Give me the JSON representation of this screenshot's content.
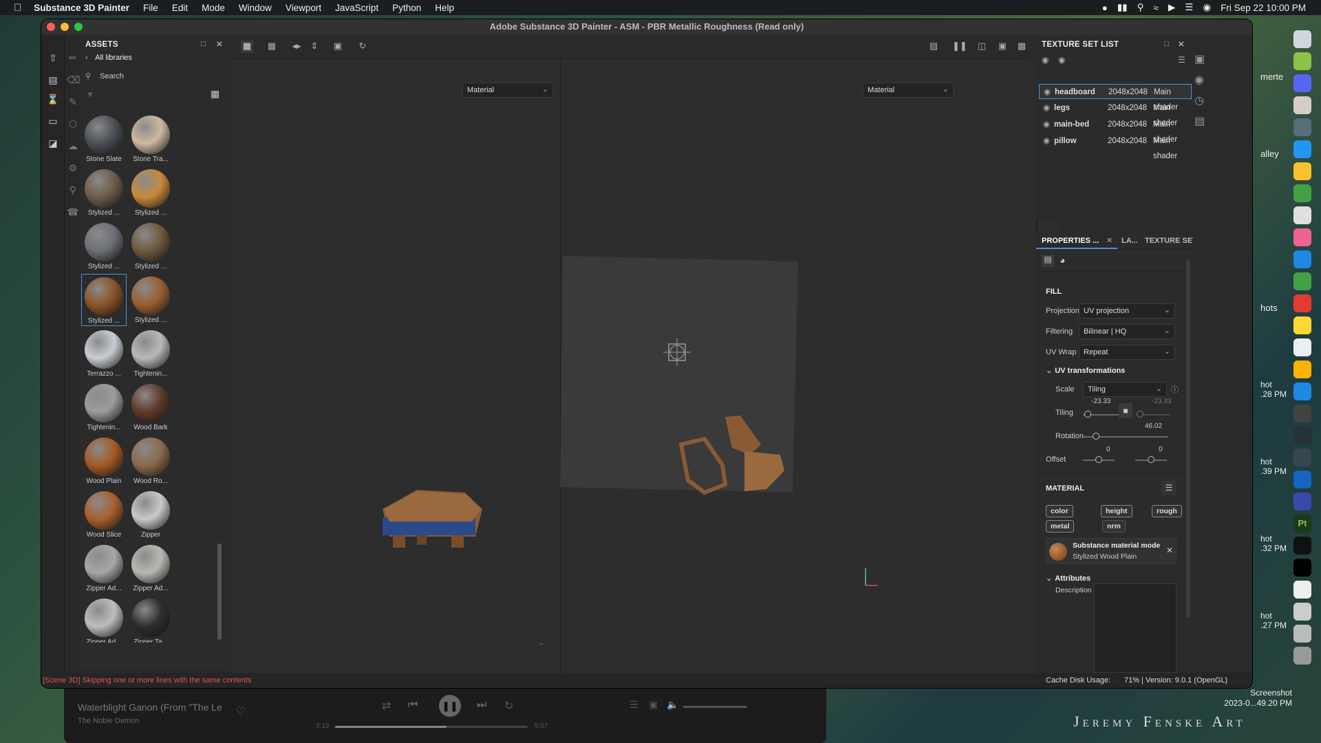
{
  "menubar": {
    "app_name": "Substance 3D Painter",
    "items": [
      "File",
      "Edit",
      "Mode",
      "Window",
      "Viewport",
      "JavaScript",
      "Python",
      "Help"
    ],
    "datetime": "Fri Sep 22  10:00 PM"
  },
  "window": {
    "title": "Adobe Substance 3D Painter - ASM - PBR Metallic Roughness (Read only)"
  },
  "assets": {
    "title": "ASSETS",
    "all_libraries": "All libraries",
    "search_placeholder": "Search",
    "swatches": [
      {
        "label": "Stone Slate",
        "color": "#4b4f57"
      },
      {
        "label": "Stone Tra...",
        "color": "#cdb9a1"
      },
      {
        "label": "Stylized ...",
        "color": "#6e5c4a"
      },
      {
        "label": "Stylized ...",
        "color": "#c9893b"
      },
      {
        "label": "Stylized ...",
        "color": "#6c6f75"
      },
      {
        "label": "Stylized ...",
        "color": "#6f5a3d"
      },
      {
        "label": "Stylized ...",
        "color": "#8b5428"
      },
      {
        "label": "Stylized ...",
        "color": "#9a5f30"
      },
      {
        "label": "Terrazzo ...",
        "color": "#c8cdd2"
      },
      {
        "label": "Tightenin...",
        "color": "#b8b8b8"
      },
      {
        "label": "Tightenin...",
        "color": "#9c9c9c"
      },
      {
        "label": "Wood Bark",
        "color": "#5e3b2a"
      },
      {
        "label": "Wood Plain",
        "color": "#a55a24"
      },
      {
        "label": "Wood Ro...",
        "color": "#8b6a4d"
      },
      {
        "label": "Wood Slice",
        "color": "#a9602c"
      },
      {
        "label": "Zipper",
        "color": "#c8c8c8"
      },
      {
        "label": "Zipper Ad...",
        "color": "#a7a7a7"
      },
      {
        "label": "Zipper Ad...",
        "color": "#b9b9b3"
      },
      {
        "label": "Zipper Ad...",
        "color": "#bdbdbd"
      },
      {
        "label": "Zipper Ta...",
        "color": "#2e2e2e"
      }
    ]
  },
  "viewport": {
    "left_dropdown": "Material",
    "right_dropdown": "Material"
  },
  "texture_set_list": {
    "title": "TEXTURE SET LIST",
    "rows": [
      {
        "name": "headboard",
        "size": "2048x2048",
        "shader": "Main shader"
      },
      {
        "name": "legs",
        "size": "2048x2048",
        "shader": "Main shader"
      },
      {
        "name": "main-bed",
        "size": "2048x2048",
        "shader": "Main shader"
      },
      {
        "name": "pillow",
        "size": "2048x2048",
        "shader": "Main shader"
      }
    ]
  },
  "properties": {
    "tabs": [
      "PROPERTIES ...",
      "LA...",
      "TEXTURE SET SET..."
    ],
    "fill_title": "FILL",
    "projection_label": "Projection",
    "projection_value": "UV projection",
    "filtering_label": "Filtering",
    "filtering_value": "Bilinear | HQ",
    "uvwrap_label": "UV Wrap",
    "uvwrap_value": "Repeat",
    "uvtrans_title": "UV transformations",
    "scale_label": "Scale",
    "scale_value": "Tiling",
    "tiling_label": "Tiling",
    "tiling_x": "-23.33",
    "tiling_y": "-23.33",
    "rotation_label": "Rotation",
    "rotation_value": "46.02",
    "offset_label": "Offset",
    "offset_x": "0",
    "offset_y": "0",
    "material_title": "MATERIAL",
    "channels": [
      "color",
      "height",
      "rough",
      "metal",
      "nrm"
    ],
    "sbsar_mode": "Substance material mode",
    "sbsar_name": "Stylized Wood Plain",
    "attributes_title": "Attributes",
    "description_label": "Description"
  },
  "status": {
    "message": "[Scene 3D] Skipping one or more lines with the same contents",
    "cache": "Cache Disk Usage:",
    "cache_value": "71% | Version: 9.0.1 (OpenGL)"
  },
  "music": {
    "song": "Waterblight Ganon (From \"The Le",
    "artist": "The Noble Demon",
    "elapsed": "3:13",
    "total": "5:07",
    "progress": 0.58
  },
  "desktop": {
    "label_1": "merte",
    "label_2": "alley",
    "label_3": "hots",
    "label_4": "hot",
    "label_4b": ".28 PM",
    "label_5": "hot",
    "label_5b": ".39 PM",
    "label_6": "hot",
    "label_6b": ".32 PM",
    "label_7": "hot",
    "label_7b": ".27 PM",
    "screenshot_name": "Screenshot",
    "screenshot_time": "2023-0...49.20 PM",
    "watermark": "Jeremy Fenske Art"
  }
}
